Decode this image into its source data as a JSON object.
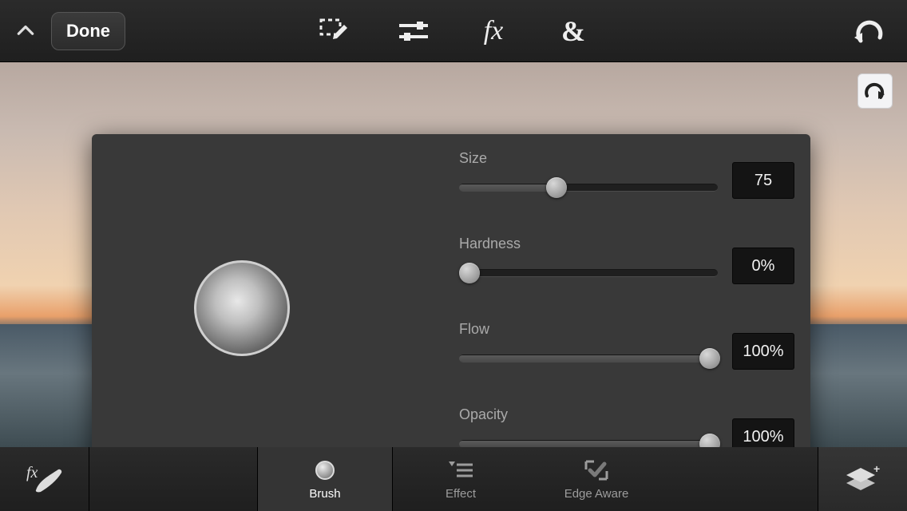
{
  "topbar": {
    "done_label": "Done"
  },
  "bottombar": {
    "tabs": {
      "brush": {
        "label": "Brush"
      },
      "effect": {
        "label": "Effect"
      },
      "edge_aware": {
        "label": "Edge Aware"
      }
    }
  },
  "brush_panel": {
    "size": {
      "label": "Size",
      "value": 75,
      "display": "75",
      "min": 0,
      "max": 200
    },
    "hardness": {
      "label": "Hardness",
      "value": 0,
      "display": "0%",
      "min": 0,
      "max": 100
    },
    "flow": {
      "label": "Flow",
      "value": 100,
      "display": "100%",
      "min": 0,
      "max": 100
    },
    "opacity": {
      "label": "Opacity",
      "value": 100,
      "display": "100%",
      "min": 0,
      "max": 100
    }
  }
}
